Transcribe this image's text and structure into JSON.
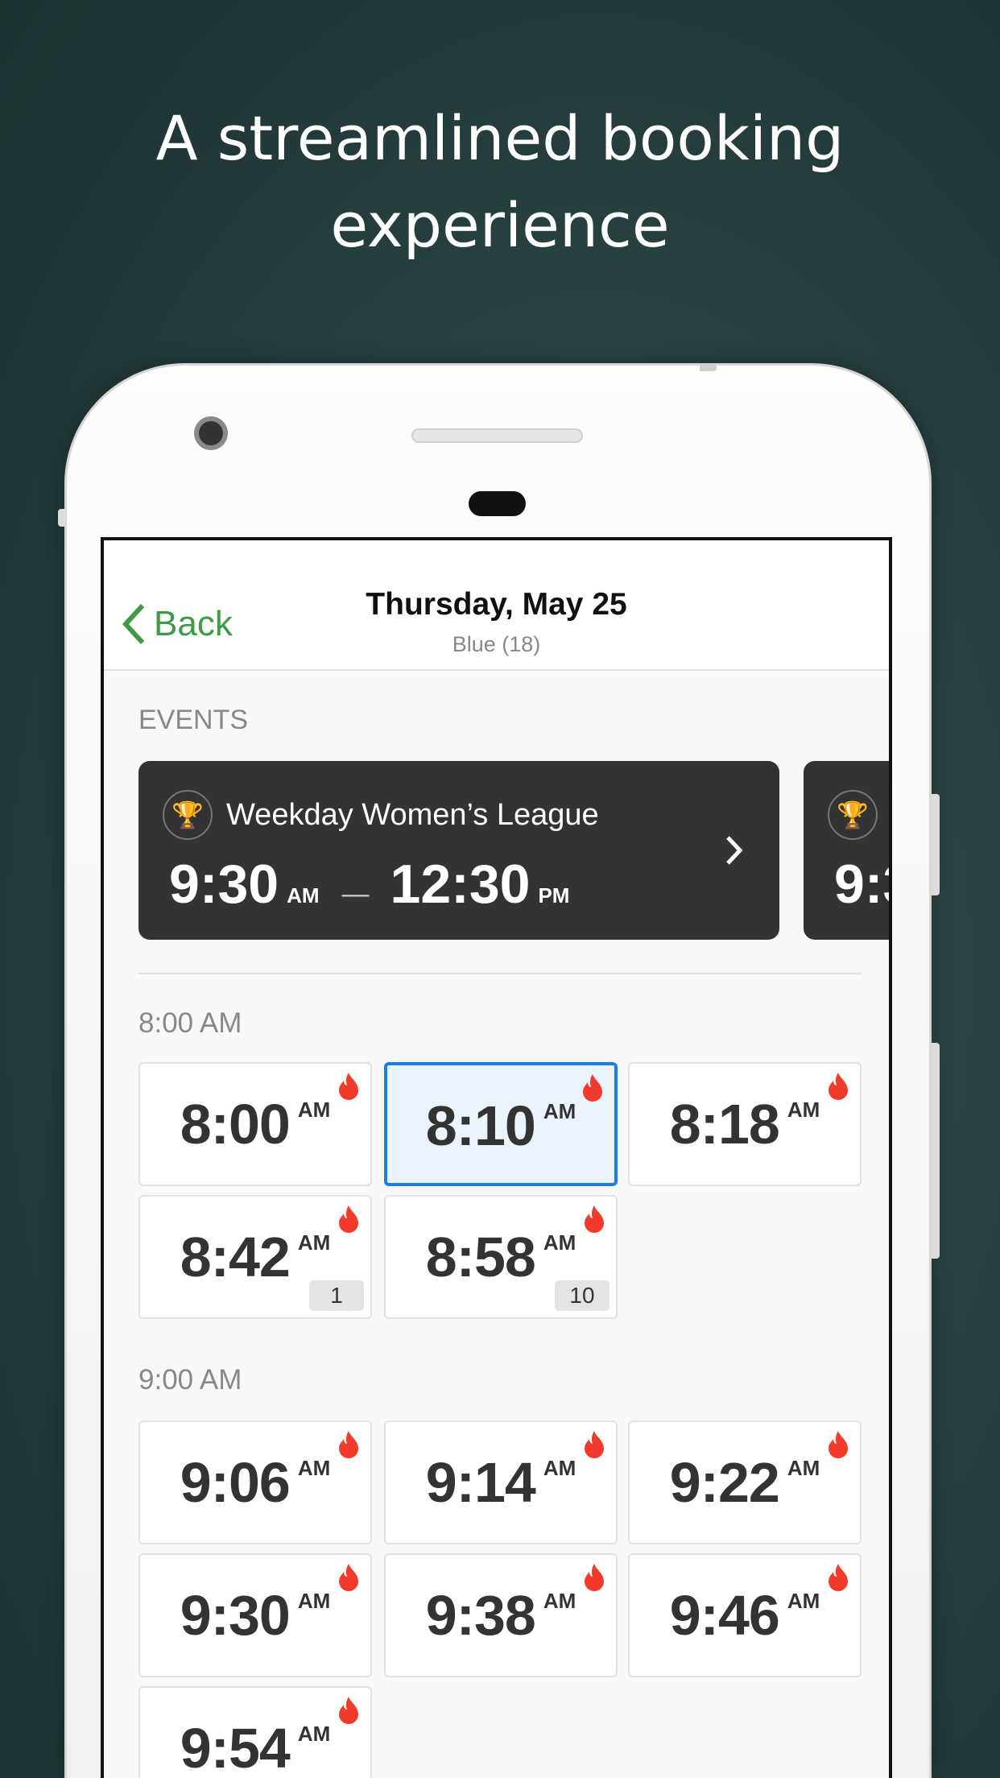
{
  "headline": {
    "line1": "A streamlined booking",
    "line2": "experience"
  },
  "header": {
    "back_label": "Back",
    "title": "Thursday, May 25",
    "subtitle": "Blue (18)"
  },
  "events": {
    "label": "EVENTS",
    "cards": [
      {
        "name": "Weekday Women’s League",
        "start": "9:30",
        "start_period": "AM",
        "end": "12:30",
        "end_period": "PM",
        "separator": "—"
      },
      {
        "start_partial": "9:3"
      }
    ]
  },
  "groups": [
    {
      "label": "8:00 AM",
      "slots": [
        {
          "time": "8:00",
          "period": "AM",
          "hot": true
        },
        {
          "time": "8:10",
          "period": "AM",
          "hot": true,
          "selected": true
        },
        {
          "time": "8:18",
          "period": "AM",
          "hot": true
        },
        {
          "time": "8:42",
          "period": "AM",
          "hot": true,
          "badge": "1"
        },
        {
          "time": "8:58",
          "period": "AM",
          "hot": true,
          "badge": "10"
        }
      ]
    },
    {
      "label": "9:00 AM",
      "slots": [
        {
          "time": "9:06",
          "period": "AM",
          "hot": true
        },
        {
          "time": "9:14",
          "period": "AM",
          "hot": true
        },
        {
          "time": "9:22",
          "period": "AM",
          "hot": true
        },
        {
          "time": "9:30",
          "period": "AM",
          "hot": true
        },
        {
          "time": "9:38",
          "period": "AM",
          "hot": true
        },
        {
          "time": "9:46",
          "period": "AM",
          "hot": true
        },
        {
          "time": "9:54",
          "period": "AM",
          "hot": true
        }
      ]
    }
  ],
  "colors": {
    "accent": "#3f9a45",
    "selected_border": "#1a7ee8",
    "flame": "#f23a2a",
    "card": "#333333"
  }
}
